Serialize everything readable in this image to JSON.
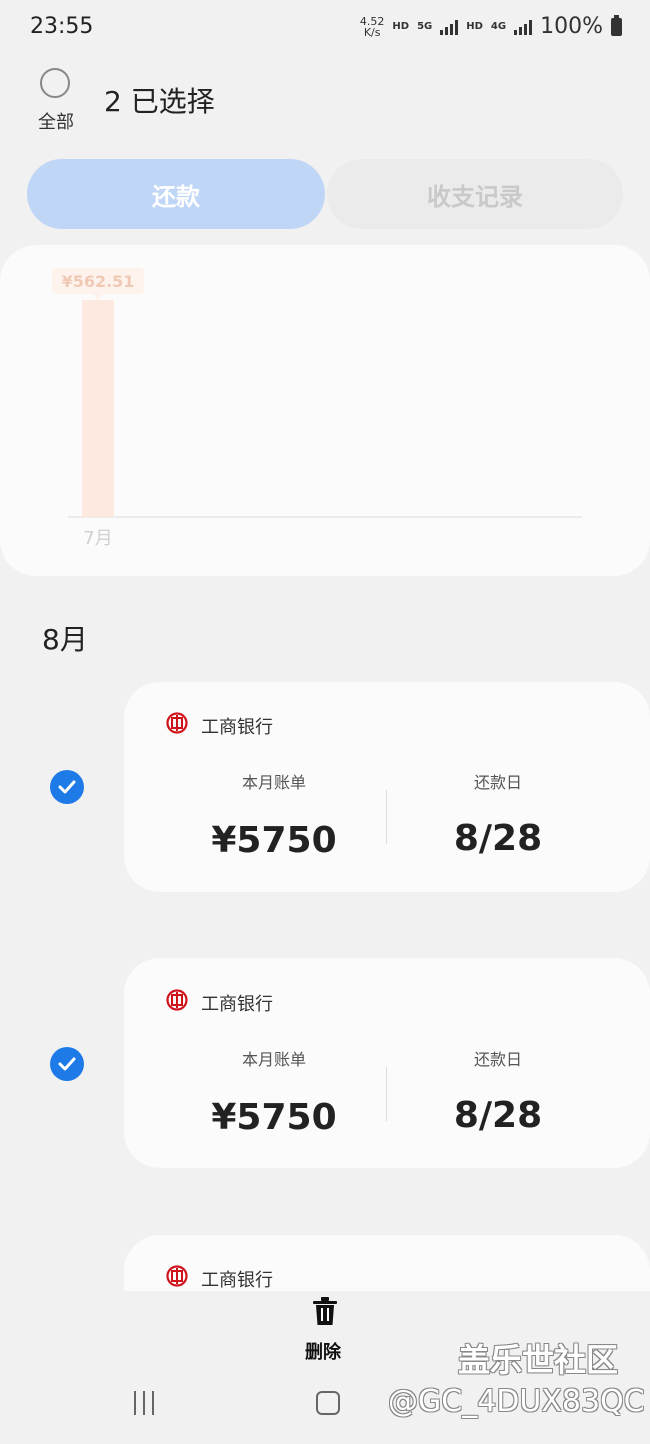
{
  "status_bar": {
    "time": "23:55",
    "net_speed_value": "4.52",
    "net_speed_unit": "K/s",
    "hd1": "HD",
    "five_g": "5G",
    "hd2": "HD",
    "four_g": "4G",
    "battery": "100%"
  },
  "header": {
    "select_all_label": "全部",
    "selection_title": "2 已选择"
  },
  "tabs": [
    {
      "label": "还款",
      "active": true
    },
    {
      "label": "收支记录",
      "active": false
    }
  ],
  "chart_data": {
    "type": "bar",
    "categories": [
      "7月"
    ],
    "values": [
      562.51
    ],
    "value_labels": [
      "¥562.51"
    ],
    "bar_color": "#fde9df",
    "label_bg": "#fdf3ec",
    "label_color": "#f0c9b6",
    "axis_color": "#e6e6e6",
    "tick_color": "#d0d0d0",
    "grid": false
  },
  "month_heading": "8月",
  "bills": [
    {
      "selected": true,
      "bank": "工商银行",
      "bill_label": "本月账单",
      "bill_amount": "¥5750",
      "due_label": "还款日",
      "due_date": "8/28"
    },
    {
      "selected": true,
      "bank": "工商银行",
      "bill_label": "本月账单",
      "bill_amount": "¥5750",
      "due_label": "还款日",
      "due_date": "8/28"
    },
    {
      "selected": false,
      "bank": "工商银行"
    }
  ],
  "actions": {
    "delete_label": "删除"
  },
  "watermark": {
    "line1": "盖乐世社区",
    "line2": "@GC_4DUX83QC"
  },
  "colors": {
    "accent": "#1e7ae6",
    "bank_red": "#d0121b"
  }
}
